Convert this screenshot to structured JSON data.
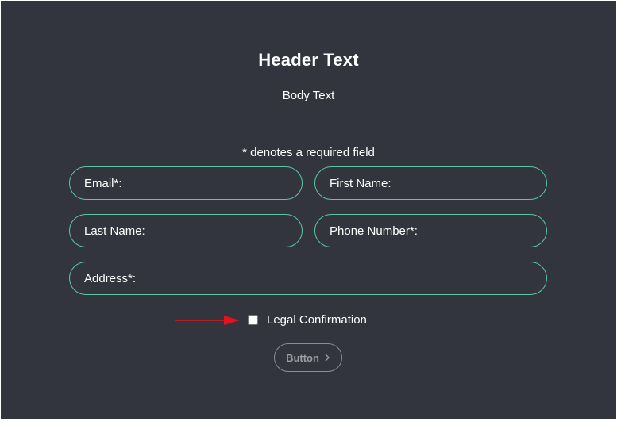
{
  "header": {
    "title": "Header Text",
    "body": "Body Text"
  },
  "form": {
    "required_note": "* denotes a required field",
    "fields": {
      "email": "Email*:",
      "first_name": "First Name:",
      "last_name": "Last Name:",
      "phone": "Phone Number*:",
      "address": "Address*:"
    },
    "legal_label": "Legal Confirmation",
    "legal_checked": false,
    "button_label": "Button",
    "button_icon": "chevron-right-icon",
    "arrow_icon": "arrow-right-icon"
  },
  "colors": {
    "background": "#32353d",
    "field_border": "#5cc6a7",
    "arrow": "#e0141e",
    "button_border": "#8a8d93"
  }
}
